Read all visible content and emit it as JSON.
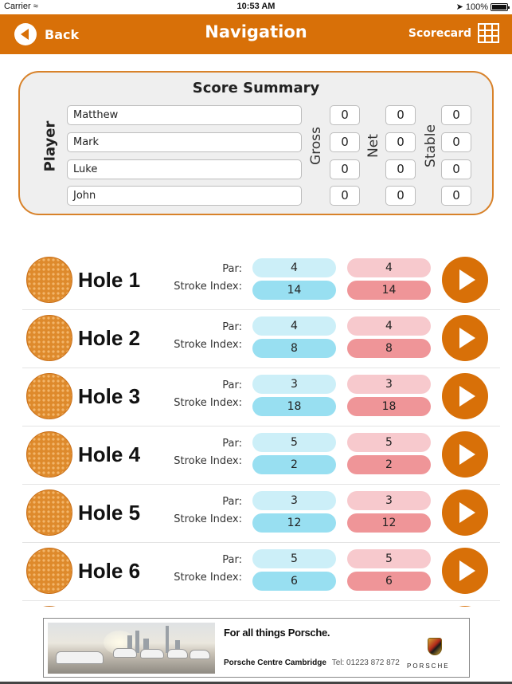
{
  "status_bar": {
    "carrier": "Carrier",
    "wifi_icon": "wifi-icon",
    "time": "10:53 AM",
    "location_icon": "location-arrow-icon",
    "battery_percent": "100%",
    "battery_level": 1.0
  },
  "nav": {
    "back_label": "Back",
    "title": "Navigation",
    "scorecard_label": "Scorecard",
    "back_icon": "back-circle-icon",
    "scorecard_icon": "grid-icon",
    "accent_color": "#d87008"
  },
  "summary": {
    "title": "Score Summary",
    "player_label": "Player",
    "gross_label": "Gross",
    "net_label": "Net",
    "stable_label": "Stable",
    "players": [
      {
        "name": "Matthew",
        "gross": "0",
        "net": "0",
        "stable": "0"
      },
      {
        "name": "Mark",
        "gross": "0",
        "net": "0",
        "stable": "0"
      },
      {
        "name": "Luke",
        "gross": "0",
        "net": "0",
        "stable": "0"
      },
      {
        "name": "John",
        "gross": "0",
        "net": "0",
        "stable": "0"
      }
    ]
  },
  "holes": {
    "par_label": "Par:",
    "stroke_index_label": "Stroke Index:",
    "items": [
      {
        "name": "Hole 1",
        "par_blue": "4",
        "si_blue": "14",
        "par_red": "4",
        "si_red": "14"
      },
      {
        "name": "Hole 2",
        "par_blue": "4",
        "si_blue": "8",
        "par_red": "4",
        "si_red": "8"
      },
      {
        "name": "Hole 3",
        "par_blue": "3",
        "si_blue": "18",
        "par_red": "3",
        "si_red": "18"
      },
      {
        "name": "Hole 4",
        "par_blue": "5",
        "si_blue": "2",
        "par_red": "5",
        "si_red": "2"
      },
      {
        "name": "Hole 5",
        "par_blue": "3",
        "si_blue": "12",
        "par_red": "3",
        "si_red": "12"
      },
      {
        "name": "Hole 6",
        "par_blue": "5",
        "si_blue": "6",
        "par_red": "5",
        "si_red": "6"
      }
    ],
    "tee_colors": {
      "blue_light": "#cceff8",
      "blue": "#98dff1",
      "red_light": "#f7c9cd",
      "red": "#ef9598"
    }
  },
  "ad": {
    "headline": "For all things Porsche.",
    "dealer": "Porsche Centre Cambridge",
    "tel": "Tel: 01223 872 872",
    "brand": "PORSCHE"
  }
}
